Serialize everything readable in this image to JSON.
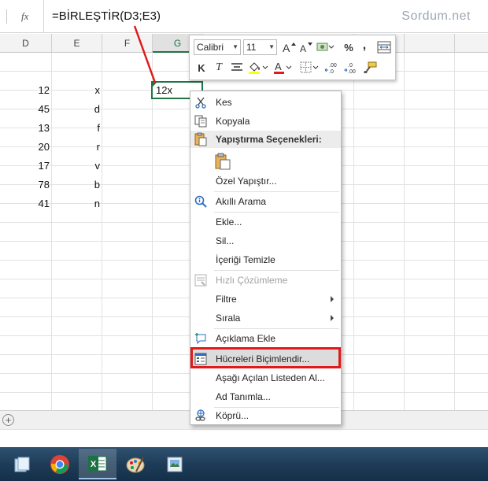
{
  "formula_bar": {
    "fx_label": "fx",
    "formula": "=BİRLEŞTİR(D3;E3)",
    "watermark": "Sordum.net"
  },
  "columns": [
    "D",
    "E",
    "F",
    "G"
  ],
  "active_column": "G",
  "rows": [
    {
      "d": "12",
      "e": "x"
    },
    {
      "d": "45",
      "e": "d"
    },
    {
      "d": "13",
      "e": "f"
    },
    {
      "d": "20",
      "e": "r"
    },
    {
      "d": "17",
      "e": "v"
    },
    {
      "d": "78",
      "e": "b"
    },
    {
      "d": "41",
      "e": "n"
    }
  ],
  "selected_cell_value": "12x",
  "mini_toolbar": {
    "font_name": "Calibri",
    "font_size": "11",
    "bold_label": "K",
    "italic_label": "T",
    "percent_label": "%",
    "comma_label": ",",
    "font_color": "#e01a1a",
    "fill_color": "#ffff00"
  },
  "context_menu": {
    "cut": "Kes",
    "copy": "Kopyala",
    "paste_options_header": "Yapıştırma Seçenekleri:",
    "paste_special": "Özel Yapıştır...",
    "smart_lookup": "Akıllı Arama",
    "insert": "Ekle...",
    "delete": "Sil...",
    "clear_contents": "İçeriği Temizle",
    "quick_analysis": "Hızlı Çözümleme",
    "filter": "Filtre",
    "sort": "Sırala",
    "insert_comment": "Açıklama Ekle",
    "format_cells": "Hücreleri Biçimlendir...",
    "pick_from_list": "Aşağı Açılan Listeden Al...",
    "define_name": "Ad Tanımla...",
    "hyperlink": "Köprü..."
  },
  "add_sheet_label": "+",
  "taskbar": {
    "apps": [
      "file-manager-icon",
      "chrome-icon",
      "excel-icon",
      "paint-icon",
      "image-viewer-icon"
    ],
    "active_app": "excel-icon"
  },
  "highlight_color": "#e01a1a",
  "accent_color": "#217346"
}
